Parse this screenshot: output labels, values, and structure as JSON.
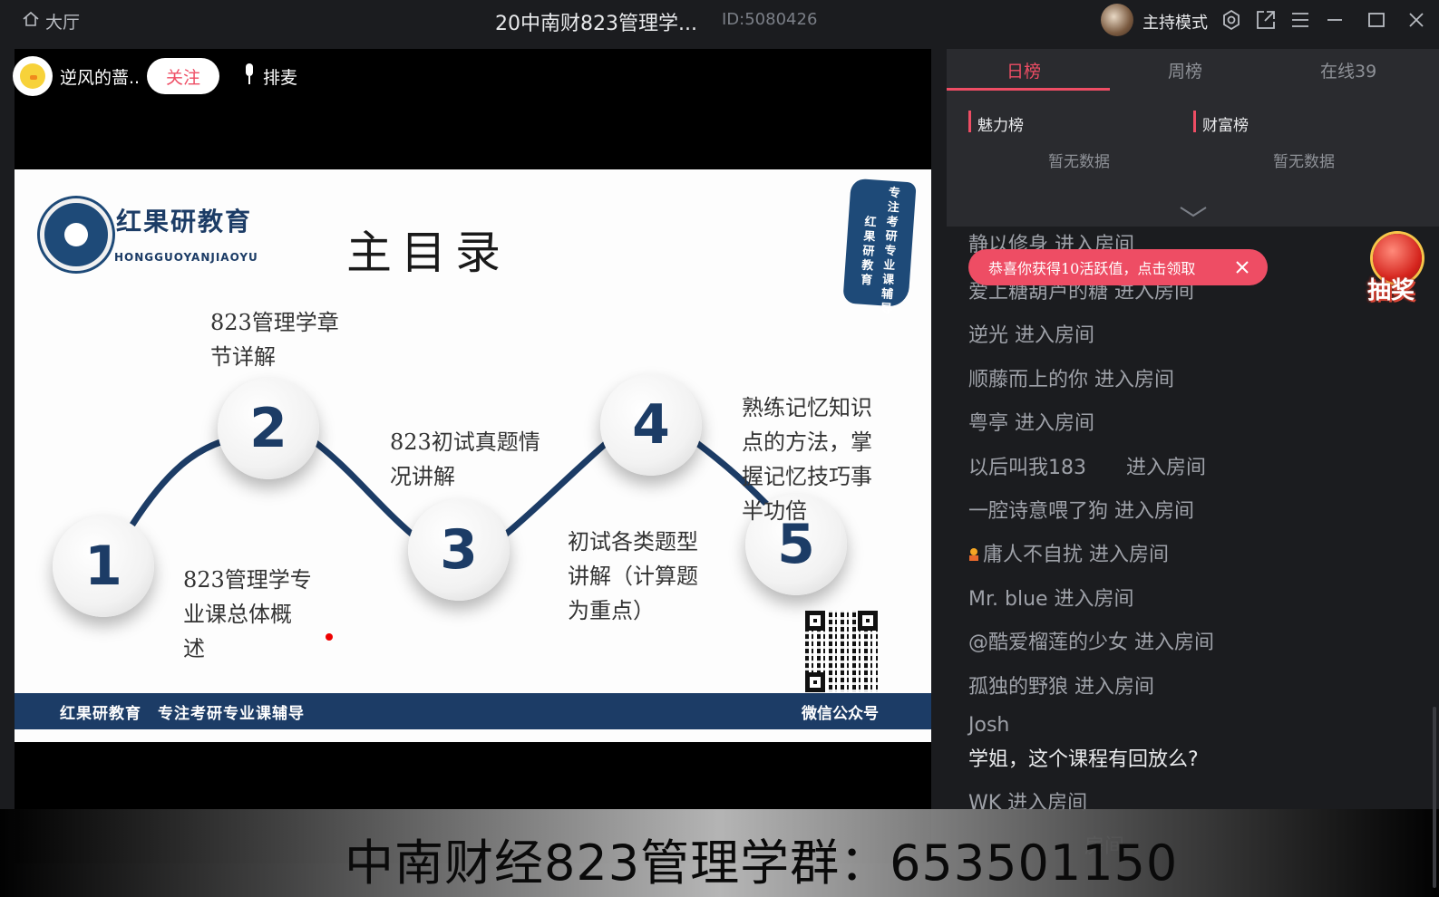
{
  "titlebar": {
    "hall_label": "大厅",
    "room_title": "20中南财823管理学...",
    "room_id": "ID:5080426",
    "host_mode": "主持模式",
    "icons": [
      "home-icon",
      "settings-icon",
      "popout-icon",
      "menu-icon",
      "minimize-icon",
      "maximize-icon",
      "close-icon"
    ]
  },
  "anchor": {
    "name": "逆风的蔷...",
    "follow_label": "关注",
    "queue_label": "排麦"
  },
  "slide": {
    "logo_text": "红果研教育",
    "logo_sub": "HONGGUOYANJIAOYU",
    "title": "主目录",
    "stamp_lines": [
      "专注考研专业课辅导",
      "红果研教育"
    ],
    "items": [
      {
        "number": "1",
        "text": [
          "823管理学专",
          "业课总体概",
          "述"
        ]
      },
      {
        "number": "2",
        "text": [
          "823管理学章",
          "节详解"
        ]
      },
      {
        "number": "3",
        "text": [
          "823初试真题情",
          "况讲解"
        ]
      },
      {
        "number": "4",
        "text": [
          "初试各类题型",
          "讲解（计算题",
          "为重点）"
        ]
      },
      {
        "number": "5",
        "text": [
          "熟练记忆知识",
          "点的方法，掌",
          "握记忆技巧事",
          "半功倍"
        ]
      }
    ],
    "footer_left": "红果研教育　专注考研专业课辅导",
    "footer_right": "微信公众号"
  },
  "caption": "中南财经823管理学群：653501150",
  "rank": {
    "tabs": [
      "日榜",
      "周榜",
      "在线39"
    ],
    "active_tab": 0,
    "charm_title": "魅力榜",
    "wealth_title": "财富榜",
    "charm_empty": "暂无数据",
    "wealth_empty": "暂无数据"
  },
  "toast": {
    "text": "恭喜你获得10活跃值，点击领取"
  },
  "lottery_label": "抽奖",
  "chat": [
    {
      "text": "静以修身 进入房间",
      "type": "enter"
    },
    {
      "text": "爱上糖葫芦的糖 进入房间",
      "type": "enter"
    },
    {
      "text": "逆光 进入房间",
      "type": "enter"
    },
    {
      "text": "顺藤而上的你 进入房间",
      "type": "enter"
    },
    {
      "text": "粤亭 进入房间",
      "type": "enter"
    },
    {
      "text": "以后叫我183　　进入房间",
      "type": "enter"
    },
    {
      "text": "一腔诗意喂了狗 进入房间",
      "type": "enter"
    },
    {
      "text": "庸人不自扰 进入房间",
      "type": "enter",
      "medal": true
    },
    {
      "text": "Mr. blue 进入房间",
      "type": "enter"
    },
    {
      "text": "@酷爱榴莲的少女 进入房间",
      "type": "enter"
    },
    {
      "text": "孤独的野狼 进入房间",
      "type": "enter"
    },
    {
      "text": "Josh",
      "type": "user"
    },
    {
      "text": "学姐，这个课程有回放么?",
      "type": "message"
    },
    {
      "text": "WK 进入房间",
      "type": "enter"
    },
    {
      "text": "房间",
      "type": "enter"
    }
  ],
  "colors": {
    "accent": "#ee4d64",
    "slide_navy": "#1c3c66",
    "background": "#1b1c1f",
    "panel": "#2a2b2f"
  }
}
